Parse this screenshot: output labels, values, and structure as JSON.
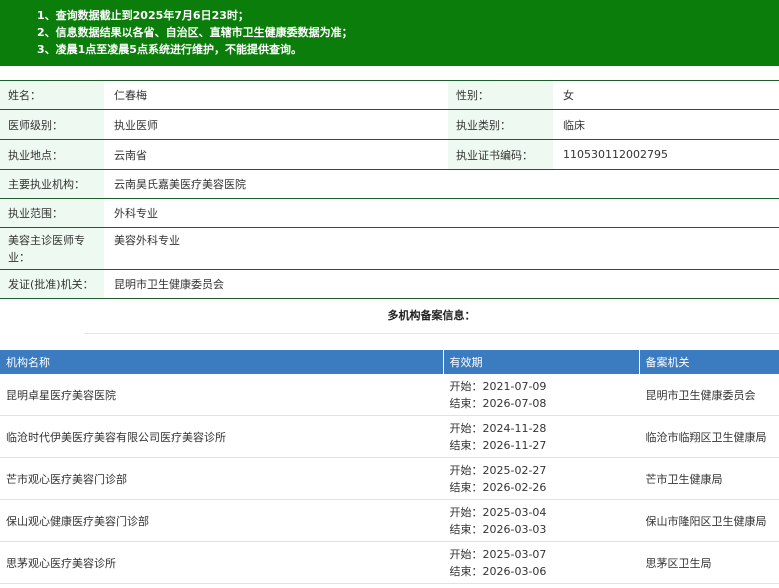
{
  "notice": {
    "line1": "1、查询数据截止到2025年7月6日23时；",
    "line2": "2、信息数据结果以各省、自治区、直辖市卫生健康委数据为准；",
    "line3": "3、凌晨1点至凌晨5点系统进行维护，不能提供查询。"
  },
  "info": {
    "name_label": "姓名：",
    "name": "仁春梅",
    "gender_label": "性别：",
    "gender": "女",
    "level_label": "医师级别：",
    "level": "执业医师",
    "category_label": "执业类别：",
    "category": "临床",
    "place_label": "执业地点：",
    "place": "云南省",
    "cert_label": "执业证书编码：",
    "cert": "110530112002795",
    "org_label": "主要执业机构：",
    "org": "云南昊氏嘉美医疗美容医院",
    "scope_label": "执业范围：",
    "scope": "外科专业",
    "beauty_label_1": "美容主诊医师专",
    "beauty_label_2": "业：",
    "beauty": "美容外科专业",
    "issuer_label": "发证(批准)机关：",
    "issuer": "昆明市卫生健康委员会"
  },
  "multi_section_title": "多机构备案信息：",
  "orgs": {
    "headers": [
      "机构名称",
      "有效期",
      "备案机关"
    ],
    "start_prefix": "开始：",
    "end_prefix": "结束：",
    "rows": [
      {
        "name": "昆明卓星医疗美容医院",
        "start": "2021-07-09",
        "end": "2026-07-08",
        "authority": "昆明市卫生健康委员会"
      },
      {
        "name": "临沧时代伊美医疗美容有限公司医疗美容诊所",
        "start": "2024-11-28",
        "end": "2026-11-27",
        "authority": "临沧市临翔区卫生健康局"
      },
      {
        "name": "芒市观心医疗美容门诊部",
        "start": "2025-02-27",
        "end": "2026-02-26",
        "authority": "芒市卫生健康局"
      },
      {
        "name": "保山观心健康医疗美容门诊部",
        "start": "2025-03-04",
        "end": "2026-03-03",
        "authority": "保山市隆阳区卫生健康局"
      },
      {
        "name": "思茅观心医疗美容诊所",
        "start": "2025-03-07",
        "end": "2026-03-06",
        "authority": "思茅区卫生局"
      }
    ]
  }
}
